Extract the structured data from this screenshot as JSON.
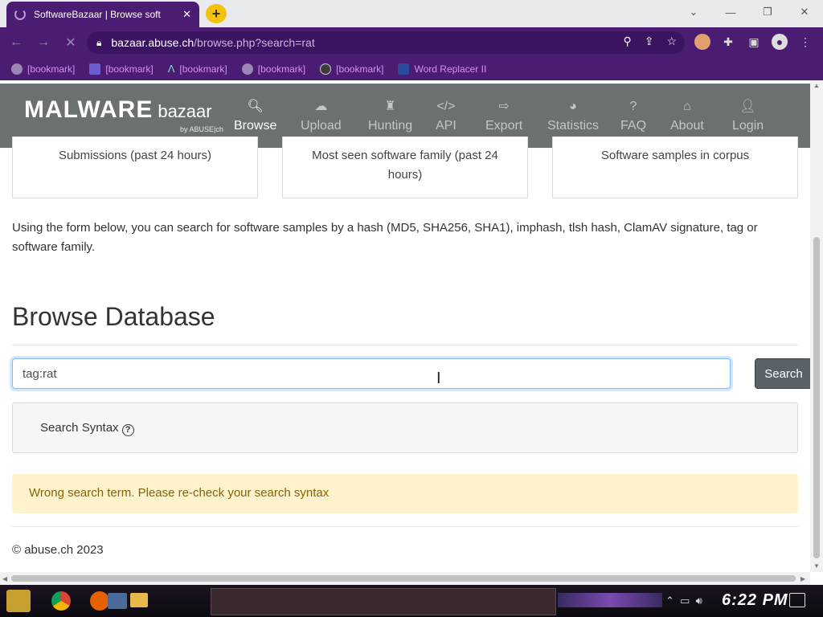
{
  "browser": {
    "tab_title": "SoftwareBazaar | Browse soft",
    "tab_close": "✕",
    "new_tab": "+",
    "url_host": "bazaar.abuse.ch",
    "url_path": "/browse.php?search=rat"
  },
  "bookmarks": [
    {
      "label": "[bookmark]",
      "icon": "globe-icon"
    },
    {
      "label": "[bookmark]",
      "icon": "square-icon"
    },
    {
      "label": "[bookmark]",
      "icon": "triangle-icon"
    },
    {
      "label": "[bookmark]",
      "icon": "globe-icon"
    },
    {
      "label": "[bookmark]",
      "icon": "mask-icon"
    },
    {
      "label": "Word Replacer II",
      "icon": "wr-icon"
    }
  ],
  "site": {
    "brand_main": "MALWARE",
    "brand_sub": "bazaar",
    "brand_by": "by ABUSE|ch",
    "nav": [
      {
        "label": "Browse",
        "icon": "search-icon",
        "glyph": "🔍︎"
      },
      {
        "label": "Upload",
        "icon": "cloud-upload-icon",
        "glyph": "☁"
      },
      {
        "label": "Hunting",
        "icon": "chess-rook-icon",
        "glyph": "♜"
      },
      {
        "label": "API",
        "icon": "code-icon",
        "glyph": "</>"
      },
      {
        "label": "Export",
        "icon": "file-export-icon",
        "glyph": "⇨"
      },
      {
        "label": "Statistics",
        "icon": "pie-chart-icon",
        "glyph": "◕"
      },
      {
        "label": "FAQ",
        "icon": "question-circle-icon",
        "glyph": "?"
      },
      {
        "label": "About",
        "icon": "building-icon",
        "glyph": "⌂"
      },
      {
        "label": "Login",
        "icon": "user-icon",
        "glyph": "👤︎"
      }
    ]
  },
  "cards": [
    {
      "text": "Submissions (past 24 hours)"
    },
    {
      "text": "Most seen software family (past 24 hours)"
    },
    {
      "text": "Software samples in corpus"
    }
  ],
  "intro_text": "Using the form below, you can search for software samples by a hash (MD5, SHA256, SHA1), imphash, tlsh hash, ClamAV signature, tag or software family.",
  "browse": {
    "heading": "Browse Database",
    "search_value": "tag:rat",
    "search_button": "Search",
    "syntax_label": "Search Syntax",
    "help_glyph": "?"
  },
  "alert": "Wrong search term. Please re-check your search syntax",
  "footer": "© abuse.ch 2023",
  "taskbar": {
    "clock": "6:22 PM"
  }
}
